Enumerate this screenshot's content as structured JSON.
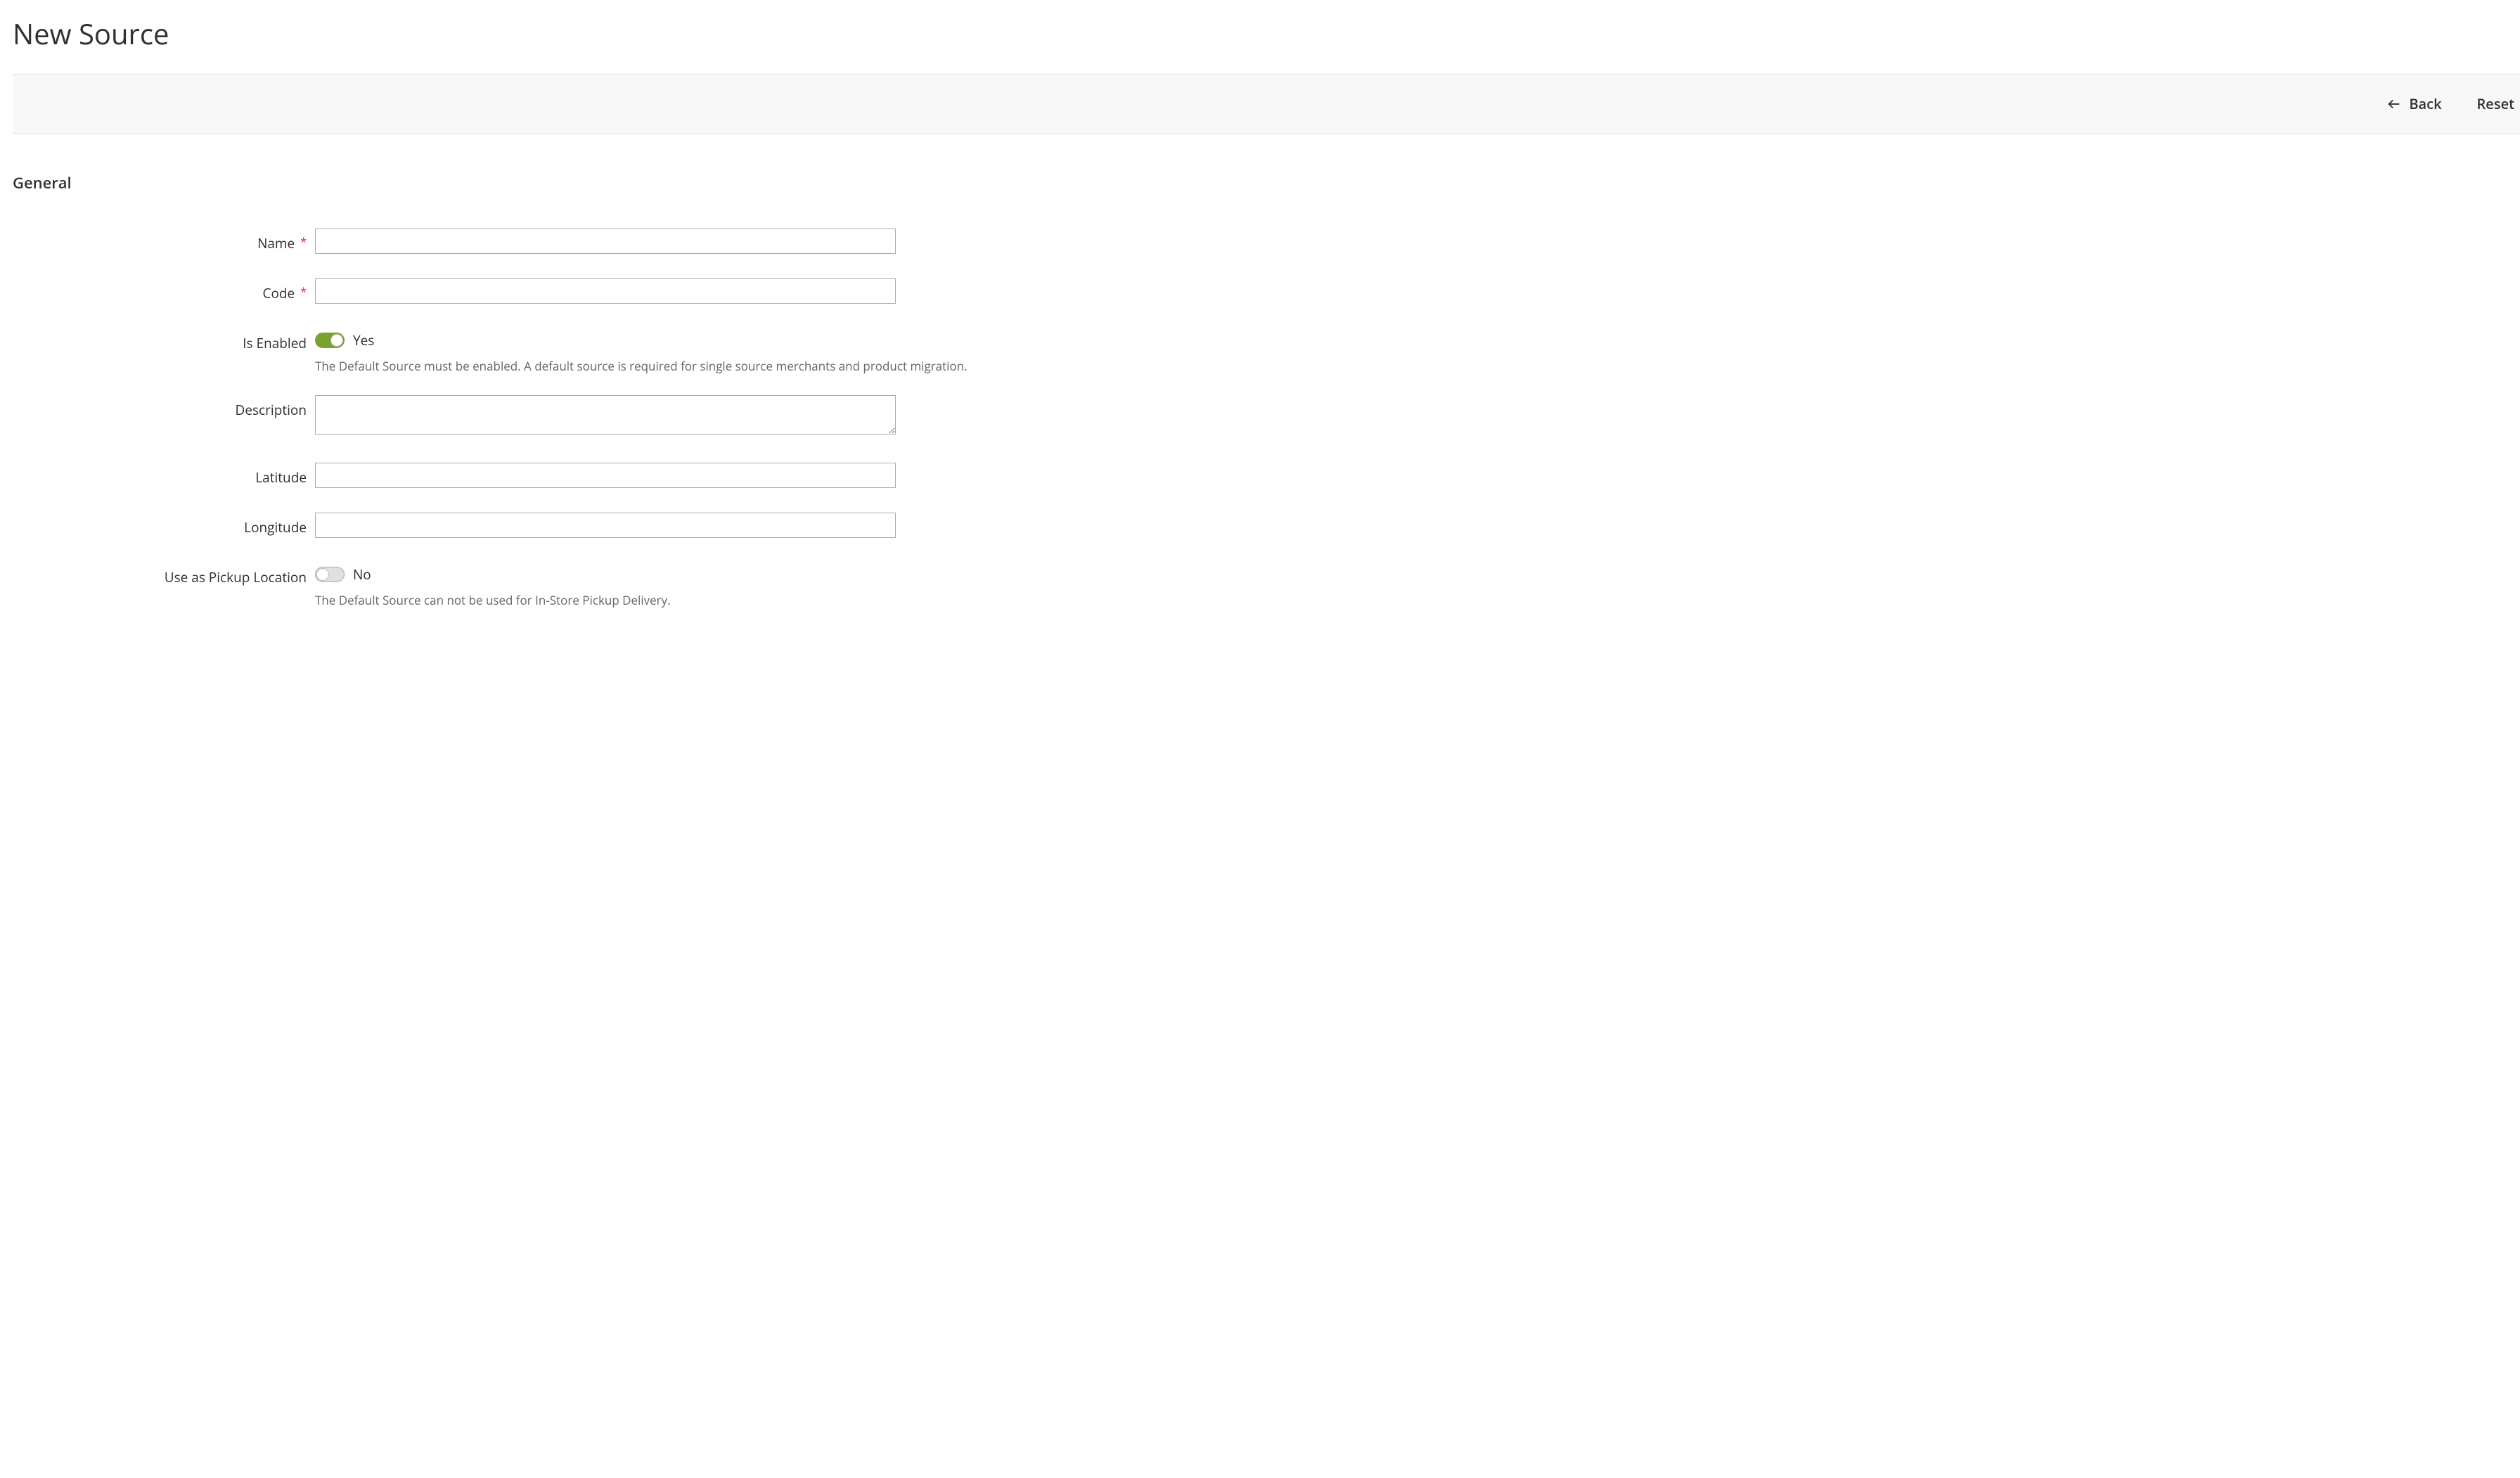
{
  "page": {
    "title": "New Source"
  },
  "actions": {
    "back": "Back",
    "reset": "Reset"
  },
  "section": {
    "general": "General"
  },
  "fields": {
    "name": {
      "label": "Name",
      "value": ""
    },
    "code": {
      "label": "Code",
      "value": ""
    },
    "is_enabled": {
      "label": "Is Enabled",
      "value": "Yes",
      "help": "The Default Source must be enabled. A default source is required for single source merchants and product migration."
    },
    "description": {
      "label": "Description",
      "value": ""
    },
    "latitude": {
      "label": "Latitude",
      "value": ""
    },
    "longitude": {
      "label": "Longitude",
      "value": ""
    },
    "pickup": {
      "label": "Use as Pickup Location",
      "value": "No",
      "help": "The Default Source can not be used for In-Store Pickup Delivery."
    }
  }
}
